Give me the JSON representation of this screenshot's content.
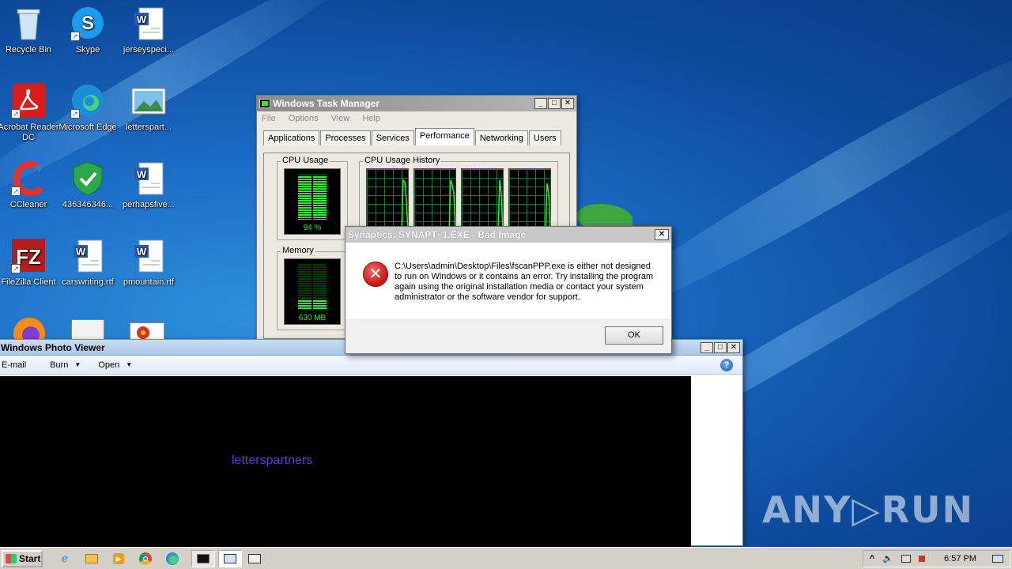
{
  "desktop": {
    "icons": [
      {
        "label": "Recycle Bin",
        "icon": "recycle-bin-icon"
      },
      {
        "label": "Skype",
        "icon": "skype-icon"
      },
      {
        "label": "jerseyspeci...",
        "icon": "word-document-icon"
      },
      {
        "label": "Acrobat Reader DC",
        "icon": "acrobat-icon"
      },
      {
        "label": "Microsoft Edge",
        "icon": "edge-icon"
      },
      {
        "label": "letterspart...",
        "icon": "image-file-icon"
      },
      {
        "label": "CCleaner",
        "icon": "ccleaner-icon"
      },
      {
        "label": "436346346...",
        "icon": "shield-icon"
      },
      {
        "label": "perhapsfive...",
        "icon": "word-document-icon"
      },
      {
        "label": "FileZilla Client",
        "icon": "filezilla-icon"
      },
      {
        "label": "carswriting.rtf",
        "icon": "word-document-icon"
      },
      {
        "label": "pmountain.rtf",
        "icon": "word-document-icon"
      }
    ]
  },
  "task_manager": {
    "title": "Windows Task Manager",
    "menu": [
      "File",
      "Options",
      "View",
      "Help"
    ],
    "tabs": [
      "Applications",
      "Processes",
      "Services",
      "Performance",
      "Networking",
      "Users"
    ],
    "active_tab": "Performance",
    "cpu_usage_label": "CPU Usage",
    "cpu_value": "94 %",
    "cpu_fraction": 0.94,
    "cpu_history_label": "CPU Usage History",
    "memory_label": "Memory",
    "memory_value": "630 MB",
    "memory_fraction": 0.2
  },
  "error_dialog": {
    "title": "Synaptics: SYNAPT~1.EXE - Bad Image",
    "message": "C:\\Users\\admin\\Desktop\\Files\\fscanPPP.exe is either not designed to run on Windows or it contains an error. Try installing the program again using the original installation media or contact your system administrator or the software vendor for support.",
    "ok_label": "OK",
    "close_glyph": "✕"
  },
  "photo_viewer": {
    "title": "Windows Photo Viewer",
    "toolbar": {
      "email": "E-mail",
      "burn": "Burn",
      "open": "Open",
      "help": "?"
    },
    "image_text": "letterspartners"
  },
  "taskbar": {
    "start_label": "Start",
    "clock": "6:57 PM",
    "tray_up": "^"
  },
  "watermark": "ANY▷RUN",
  "colors": {
    "desktop_bg": "#1a6bc4",
    "titlebar_active": "#0a246a",
    "titlebar_inactive": "#808080",
    "meter_green": "#2ef02e",
    "image_text": "#5a3fd0"
  }
}
